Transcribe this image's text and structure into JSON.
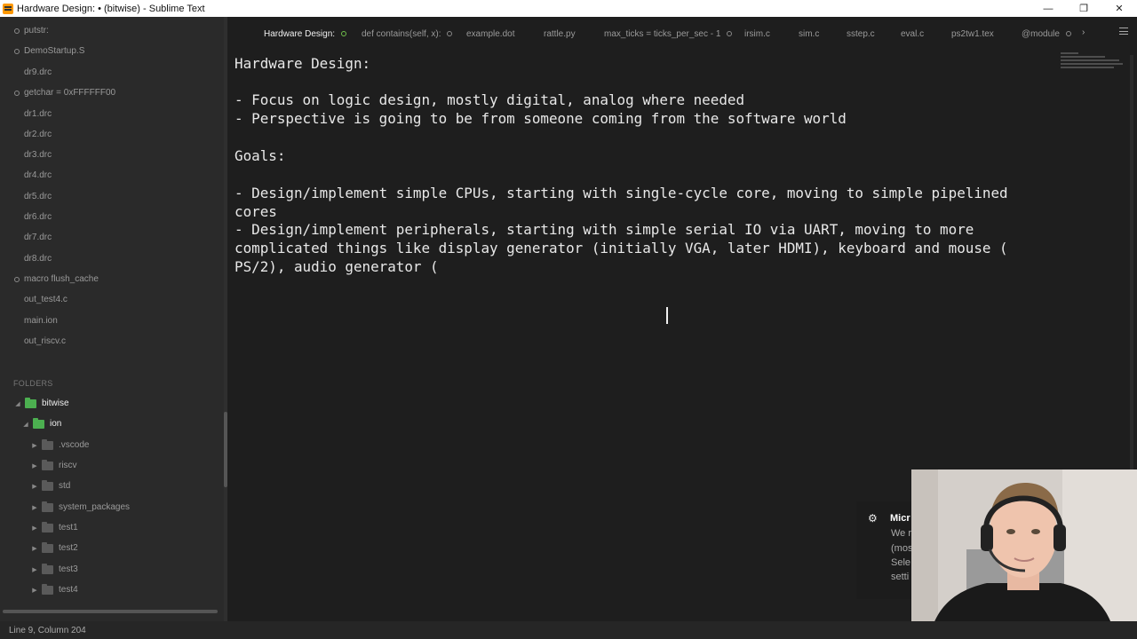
{
  "window": {
    "title": "Hardware Design: • (bitwise) - Sublime Text",
    "minimize": "—",
    "restore": "❐",
    "close": "✕"
  },
  "sidebar": {
    "open_files": [
      "putstr:",
      "DemoStartup.S",
      "dr9.drc",
      "getchar = 0xFFFFFF00",
      "dr1.drc",
      "dr2.drc",
      "dr3.drc",
      "dr4.drc",
      "dr5.drc",
      "dr6.drc",
      "dr7.drc",
      "dr8.drc",
      "macro flush_cache",
      "out_test4.c",
      "main.ion",
      "out_riscv.c"
    ],
    "folders_label": "FOLDERS",
    "tree": [
      {
        "label": "bitwise",
        "expanded": true,
        "selected": true
      },
      {
        "label": "ion",
        "expanded": true,
        "selected": true
      },
      {
        "label": ".vscode",
        "expanded": false
      },
      {
        "label": "riscv",
        "expanded": false
      },
      {
        "label": "std",
        "expanded": false
      },
      {
        "label": "system_packages",
        "expanded": false
      },
      {
        "label": "test1",
        "expanded": false
      },
      {
        "label": "test2",
        "expanded": false
      },
      {
        "label": "test3",
        "expanded": false
      },
      {
        "label": "test4",
        "expanded": false
      }
    ]
  },
  "tabs": [
    {
      "label": "Hardware Design:",
      "active": true,
      "modified": true
    },
    {
      "label": "def contains(self, x):",
      "modified": true
    },
    {
      "label": "example.dot"
    },
    {
      "label": "rattle.py"
    },
    {
      "label": "max_ticks = ticks_per_sec - 1",
      "modified": true
    },
    {
      "label": "irsim.c"
    },
    {
      "label": "sim.c"
    },
    {
      "label": "sstep.c"
    },
    {
      "label": "eval.c"
    },
    {
      "label": "ps2tw1.tex"
    },
    {
      "label": "@module",
      "modified": true
    }
  ],
  "editor": {
    "lines": [
      "Hardware Design:",
      "",
      "- Focus on logic design, mostly digital, analog where needed",
      "- Perspective is going to be from someone coming from the software world",
      "",
      "Goals:",
      "",
      "- Design/implement simple CPUs, starting with single-cycle core, moving to simple pipelined",
      "cores",
      "- Design/implement peripherals, starting with simple serial IO via UART, moving to more",
      "complicated things like display generator (initially VGA, later HDMI), keyboard and mouse (",
      "PS/2), audio generator ("
    ]
  },
  "notification": {
    "title": "Micr",
    "lines": [
      "We r",
      "(mos",
      "Sele",
      "setti"
    ]
  },
  "status": {
    "position": "Line 9, Column 204"
  },
  "colors": {
    "accent_green": "#4caf50",
    "background": "#1e1e1e",
    "sidebar": "#2a2a2a"
  }
}
